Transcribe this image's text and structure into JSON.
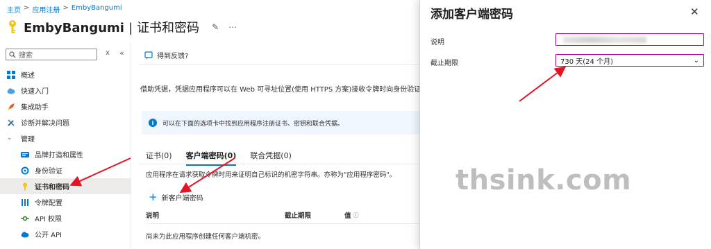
{
  "breadcrumb": {
    "items": [
      "主页",
      "应用注册",
      "EmbyBangumi"
    ],
    "separator": ">"
  },
  "header": {
    "app_name": "EmbyBangumi",
    "section": "证书和密码",
    "pin_icon": "pin-icon",
    "more_icon": "ellipsis-icon"
  },
  "sidebar": {
    "search_placeholder": "搜索",
    "items": [
      {
        "label": "概述",
        "icon": "grid-icon",
        "level": 0
      },
      {
        "label": "快速入门",
        "icon": "cloud-icon",
        "level": 0
      },
      {
        "label": "集成助手",
        "icon": "rocket-icon",
        "level": 0
      },
      {
        "label": "诊断并解决问题",
        "icon": "wrench-icon",
        "level": 0
      },
      {
        "label": "管理",
        "icon": "chevron-down-icon",
        "level": 0
      },
      {
        "label": "品牌打造和属性",
        "icon": "card-icon",
        "level": 1
      },
      {
        "label": "身份验证",
        "icon": "refresh-icon",
        "level": 1
      },
      {
        "label": "证书和密码",
        "icon": "key-icon",
        "level": 1,
        "active": true
      },
      {
        "label": "令牌配置",
        "icon": "bars-icon",
        "level": 1
      },
      {
        "label": "API 权限",
        "icon": "api-icon",
        "level": 1
      },
      {
        "label": "公开 API",
        "icon": "cloud-api-icon",
        "level": 1
      }
    ]
  },
  "main": {
    "feedback": "得到反馈?",
    "description": "借助凭据，凭据应用程序可以在 Web 可寻址位置(使用 HTTPS 方案)接收令牌时向身份验证服务标",
    "info_banner": "可以在下面的选项卡中找到应用程序注册证书、密钥和联合凭据。",
    "tabs": [
      {
        "label": "证书(0)",
        "active": false
      },
      {
        "label": "客户端密码(0)",
        "active": true
      },
      {
        "label": "联合凭据(0)",
        "active": false
      }
    ],
    "tab_description": "应用程序在请求获取令牌时用来证明自己标识的机密字符串。亦称为\"应用程序密码\"。",
    "new_secret": "新客户端密码",
    "table": {
      "headers": [
        "说明",
        "截止期限",
        "值"
      ],
      "empty_text": "尚未为此应用程序创建任何客户端机密。"
    }
  },
  "panel": {
    "title": "添加客户端密码",
    "fields": {
      "description_label": "说明",
      "description_value": "",
      "expiry_label": "截止期限",
      "expiry_value": "730 天(24 个月)"
    }
  },
  "watermark": "thsink.com",
  "colors": {
    "accent": "#0078d4",
    "annotation_arrow": "#e81123",
    "field_border": "#b4009e"
  }
}
